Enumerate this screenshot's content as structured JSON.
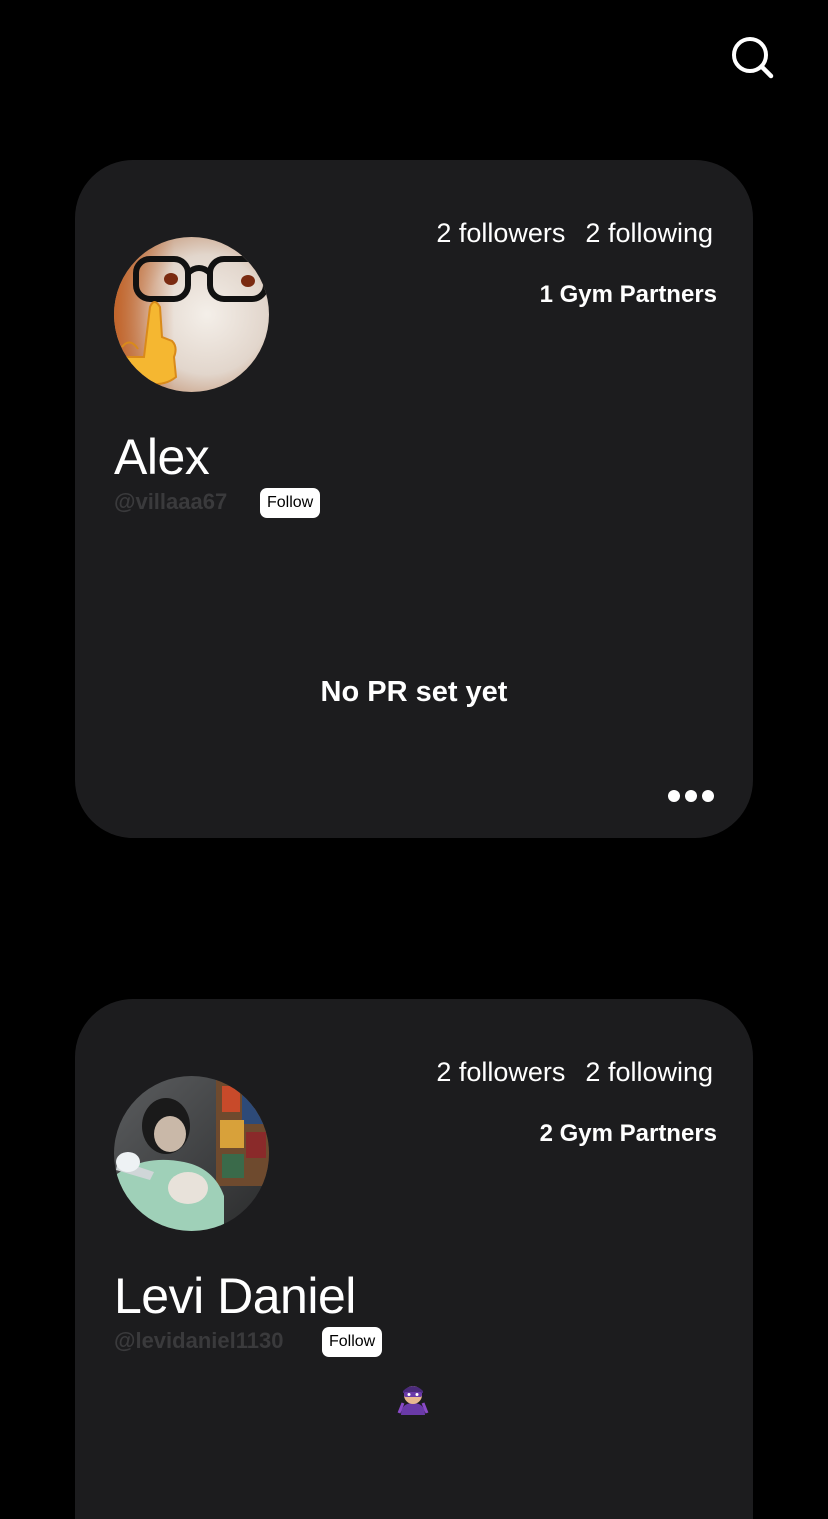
{
  "header": {
    "search_icon": "search-icon"
  },
  "profiles": [
    {
      "followers_text": "2 followers",
      "following_text": "2 following",
      "gym_partners_text": "1 Gym Partners",
      "name": "Alex",
      "handle": "@villaaa67",
      "follow_label": "Follow",
      "pr_text": "No PR set yet",
      "more_icon": "more-horizontal-icon"
    },
    {
      "followers_text": "2 followers",
      "following_text": "2 following",
      "gym_partners_text": "2 Gym Partners",
      "name": "Levi Daniel",
      "handle": "@levidaniel1130",
      "follow_label": "Follow",
      "badge_icon": "superhero-emoji-icon"
    }
  ],
  "colors": {
    "background": "#000000",
    "card": "#1c1c1e",
    "handle_text": "#3a3a3c",
    "primary_text": "#ffffff"
  }
}
